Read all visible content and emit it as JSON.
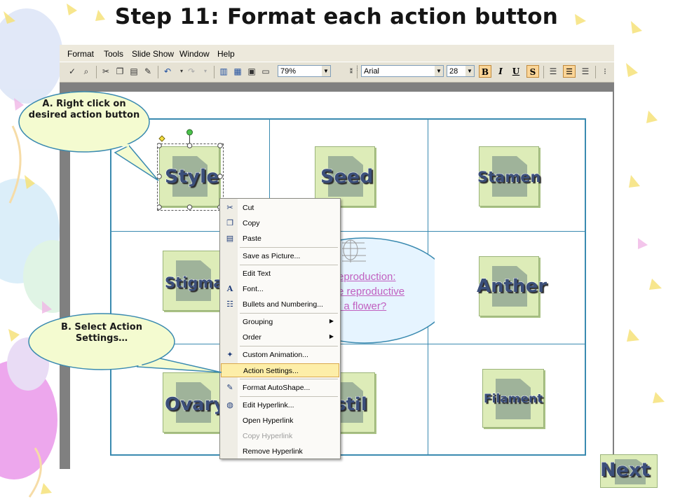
{
  "slide": {
    "title": "Step 11: Format each action button"
  },
  "menubar": {
    "items": [
      "Format",
      "Tools",
      "Slide Show",
      "Window",
      "Help"
    ]
  },
  "toolbar": {
    "zoom": "79%",
    "font_name": "Arial",
    "font_size": "28",
    "bold_label": "B",
    "italic_label": "I",
    "underline_label": "U",
    "shadow_label": "S"
  },
  "buttons": {
    "style": "Style",
    "seed": "Seed",
    "stamen": "Stamen",
    "stigma": "Stigma",
    "anther": "Anther",
    "ovary": "Ovary",
    "pistil": "stil",
    "filament": "Filament"
  },
  "center_shape": {
    "line1": "eproduction:",
    "line2": "e reproductive",
    "line3": "f a flower?"
  },
  "context_menu": {
    "items": [
      {
        "label": "Cut",
        "icon": "scissors-icon"
      },
      {
        "label": "Copy",
        "icon": "copy-icon"
      },
      {
        "label": "Paste",
        "icon": "paste-icon"
      },
      {
        "label": "Save as Picture..."
      },
      {
        "label": "Edit Text"
      },
      {
        "label": "Font...",
        "icon": "font-icon"
      },
      {
        "label": "Bullets and Numbering...",
        "icon": "bullets-icon"
      },
      {
        "label": "Grouping"
      },
      {
        "label": "Order"
      },
      {
        "label": "Custom Animation...",
        "icon": "animation-icon"
      },
      {
        "label": "Action Settings..."
      },
      {
        "label": "Format AutoShape...",
        "icon": "format-shape-icon"
      },
      {
        "label": "Edit Hyperlink...",
        "icon": "hyperlink-icon"
      },
      {
        "label": "Open Hyperlink"
      },
      {
        "label": "Copy Hyperlink"
      },
      {
        "label": "Remove Hyperlink"
      }
    ]
  },
  "callouts": {
    "a": "A.  Right click on desired action button",
    "b": "B.  Select Action Settings…"
  },
  "next_button": {
    "label": "Next"
  },
  "colors": {
    "grid_line": "#3a8ab0",
    "button_fill": "#ddecb8",
    "label_text": "#3b4f7a",
    "callout_fill": "#f4fbd0",
    "highlight": "#fdeea8",
    "center_shape_fill": "#e6f4ff",
    "center_text": "#c060c0"
  }
}
